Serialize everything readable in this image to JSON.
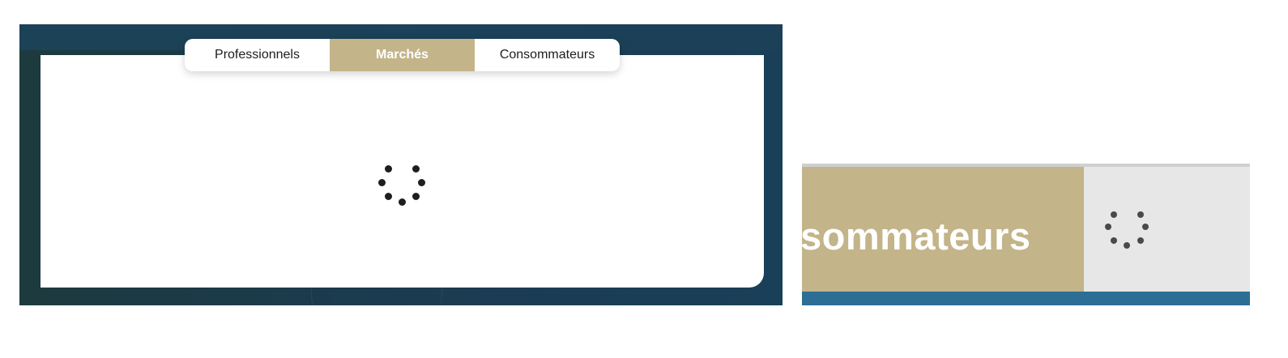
{
  "tabs": [
    {
      "label": "Professionnels",
      "active": false
    },
    {
      "label": "Marchés",
      "active": true
    },
    {
      "label": "Consommateurs",
      "active": false
    }
  ],
  "zoom": {
    "tab_label_fragment": "sommateurs"
  },
  "colors": {
    "active_tab": "#c3b489",
    "panel_dark": "#1b3b4f",
    "spinner": "#1e1e1e",
    "zoom_gray": "#e7e7e7",
    "zoom_blue": "#2d6e94"
  },
  "icons": {
    "loading": "loading-spinner-icon"
  }
}
